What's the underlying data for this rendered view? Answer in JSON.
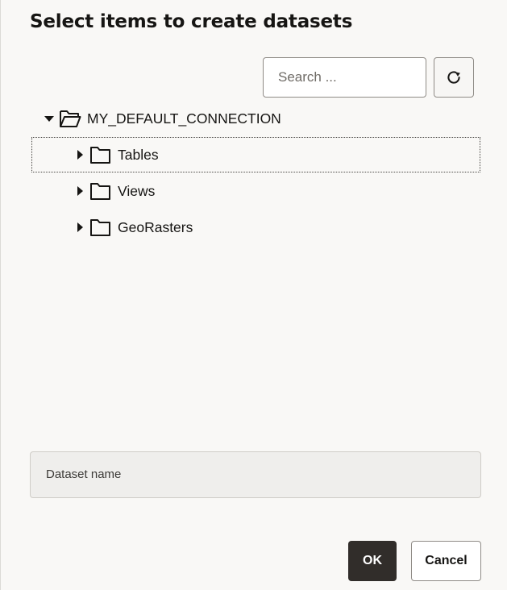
{
  "dialog": {
    "title": "Select items to create datasets"
  },
  "search": {
    "placeholder": "Search ...",
    "value": ""
  },
  "toolbar": {
    "refresh_icon": "refresh-icon"
  },
  "tree": {
    "root": {
      "label": "MY_DEFAULT_CONNECTION",
      "expanded": true,
      "icon": "folder-open-icon"
    },
    "children": [
      {
        "label": "Tables",
        "expanded": false,
        "focused": true,
        "icon": "folder-icon"
      },
      {
        "label": "Views",
        "expanded": false,
        "focused": false,
        "icon": "folder-icon"
      },
      {
        "label": "GeoRasters",
        "expanded": false,
        "focused": false,
        "icon": "folder-icon"
      }
    ]
  },
  "dataset_name": {
    "label": "Dataset name",
    "value": ""
  },
  "buttons": {
    "ok_label": "OK",
    "cancel_label": "Cancel"
  },
  "colors": {
    "primary_button": "#312d2a",
    "background": "#f9f8f6",
    "text": "#161513"
  }
}
